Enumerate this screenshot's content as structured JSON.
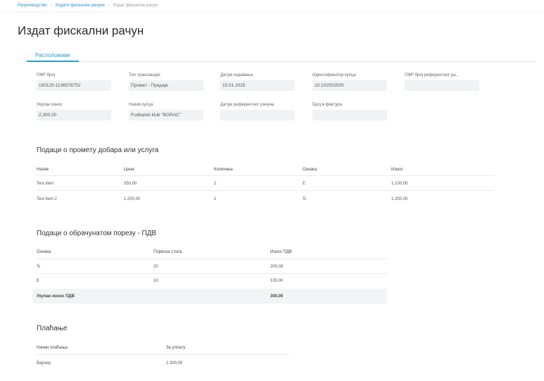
{
  "breadcrumb": [
    "Рачуноводство",
    "Издати фискални рачуни",
    "Издат фискални рачун"
  ],
  "page_title": "Издат фискални рачун",
  "tab_label": "Расположиве",
  "fields": [
    {
      "label": "ПФР број",
      "value": "150125-1136578752"
    },
    {
      "label": "Тип трансакције",
      "value": "Промет - Продаја"
    },
    {
      "label": "Датум издавања",
      "value": "15.01.2025"
    },
    {
      "label": "Идентификатор купца",
      "value": "10:102553500"
    },
    {
      "label": "ПФР број референтног ра...",
      "value": ""
    },
    {
      "label": "Укупан износ",
      "value": "2.300,00"
    },
    {
      "label": "Назив купца",
      "value": "Fudbalski klub \"BORAC\""
    },
    {
      "label": "Датум референтног рачуна",
      "value": ""
    },
    {
      "label": "Број в фактура",
      "value": ""
    }
  ],
  "goods": {
    "title": "Подаци о промету добара или услуга",
    "headers": [
      "Назив",
      "Цена",
      "Количина",
      "Ознака",
      "Износ"
    ],
    "rows": [
      [
        "Test item",
        "550,00",
        "2",
        "Е",
        "1.100,00"
      ],
      [
        "Test item 2",
        "1.200,00",
        "1",
        "Ђ",
        "1.200,00"
      ]
    ]
  },
  "tax": {
    "title": "Подаци о обрачунатом порезу - ПДВ",
    "headers": [
      "Ознака",
      "Пореска стопа",
      "Износ ПДВ"
    ],
    "rows": [
      [
        "Ђ",
        "20",
        "200,00"
      ],
      [
        "Е",
        "10",
        "100,00"
      ]
    ],
    "total_label": "Укупан износ ПДВ",
    "total_value": "300,00"
  },
  "payment": {
    "title": "Плаћање",
    "headers": [
      "Начин плаћања",
      "За уплату"
    ],
    "rows": [
      [
        "Ваучер",
        "2.300,00"
      ]
    ]
  }
}
